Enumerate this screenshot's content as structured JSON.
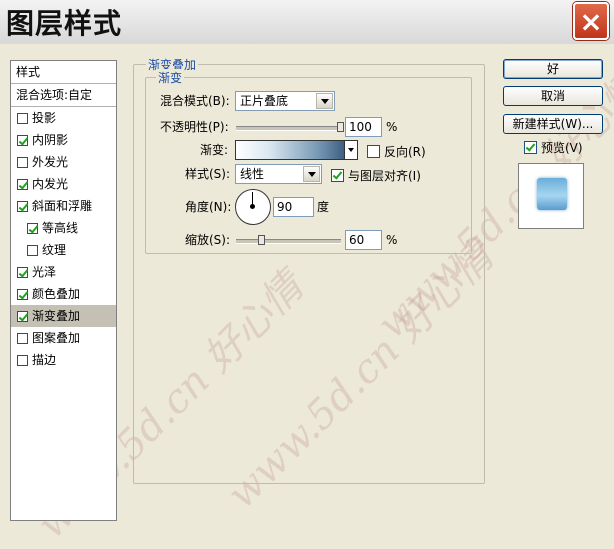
{
  "window": {
    "title": "图层样式",
    "close_icon": "×"
  },
  "style_list": {
    "header": "样式",
    "blend_options": "混合选项:自定",
    "items": [
      {
        "label": "投影",
        "checked": false,
        "indent": false,
        "active": false
      },
      {
        "label": "内阴影",
        "checked": true,
        "indent": false,
        "active": false
      },
      {
        "label": "外发光",
        "checked": false,
        "indent": false,
        "active": false
      },
      {
        "label": "内发光",
        "checked": true,
        "indent": false,
        "active": false
      },
      {
        "label": "斜面和浮雕",
        "checked": true,
        "indent": false,
        "active": false
      },
      {
        "label": "等高线",
        "checked": true,
        "indent": true,
        "active": false
      },
      {
        "label": "纹理",
        "checked": false,
        "indent": true,
        "active": false
      },
      {
        "label": "光泽",
        "checked": true,
        "indent": false,
        "active": false
      },
      {
        "label": "颜色叠加",
        "checked": true,
        "indent": false,
        "active": false
      },
      {
        "label": "渐变叠加",
        "checked": true,
        "indent": false,
        "active": true
      },
      {
        "label": "图案叠加",
        "checked": false,
        "indent": false,
        "active": false
      },
      {
        "label": "描边",
        "checked": false,
        "indent": false,
        "active": false
      }
    ]
  },
  "gradient_overlay": {
    "group_title": "渐变叠加",
    "sub_group_title": "渐变",
    "blend_mode_label": "混合模式(B):",
    "blend_mode_value": "正片叠底",
    "opacity_label": "不透明性(P):",
    "opacity_value": "100",
    "opacity_fraction": 1.0,
    "opacity_unit": "%",
    "gradient_label": "渐变:",
    "reverse_label": "反向(R)",
    "reverse_checked": false,
    "style_label": "样式(S):",
    "style_value": "线性",
    "align_label": "与图层对齐(I)",
    "align_checked": true,
    "angle_label": "角度(N):",
    "angle_value": "90",
    "angle_unit": "度",
    "scale_label": "缩放(S):",
    "scale_value": "60",
    "scale_fraction": 0.25,
    "scale_unit": "%"
  },
  "buttons": {
    "ok": "好",
    "cancel": "取消",
    "new_style": "新建样式(W)...",
    "preview": "预览(V)",
    "preview_checked": true
  },
  "watermark": "www.5d.cn 好心情",
  "colors": {
    "accent_text": "#1a4ba6",
    "close_button": "#c0341c"
  }
}
